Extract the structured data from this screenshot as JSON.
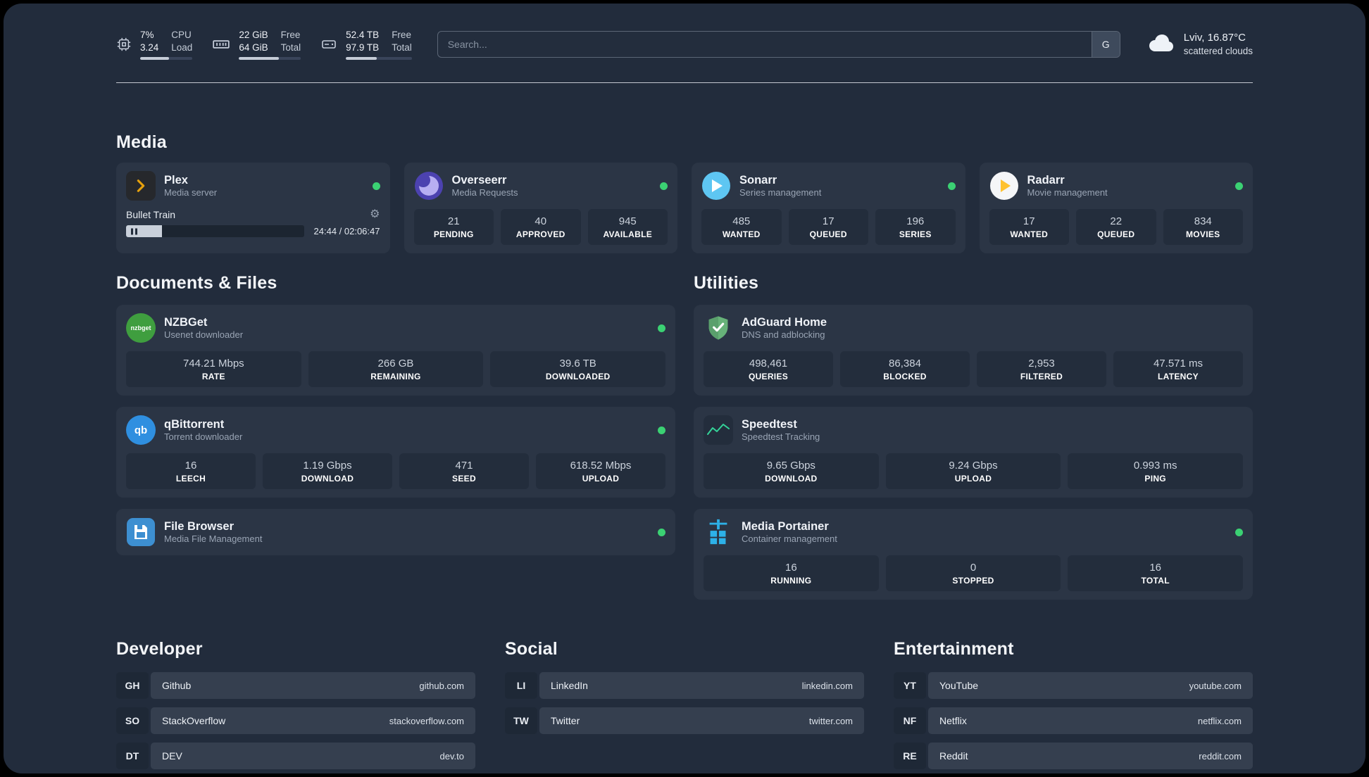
{
  "header": {
    "cpu": {
      "percent": "7%",
      "load": "3.24",
      "label1": "CPU",
      "label2": "Load",
      "bar_percent": 55
    },
    "ram": {
      "free": "22 GiB",
      "total": "64 GiB",
      "label1": "Free",
      "label2": "Total",
      "bar_percent": 65
    },
    "disk": {
      "free": "52.4 TB",
      "total": "97.9 TB",
      "label1": "Free",
      "label2": "Total",
      "bar_percent": 47
    },
    "search": {
      "placeholder": "Search...",
      "button_label": "G"
    },
    "weather": {
      "location": "Lviv, 16.87°C",
      "condition": "scattered clouds"
    }
  },
  "icons": {
    "gear": "⚙"
  },
  "sections": {
    "media": {
      "title": "Media",
      "plex": {
        "name": "Plex",
        "subtitle": "Media server",
        "now_playing": "Bullet Train",
        "time": "24:44 / 02:06:47",
        "progress_percent": 20
      },
      "overseerr": {
        "name": "Overseerr",
        "subtitle": "Media Requests",
        "stats": [
          {
            "value": "21",
            "label": "PENDING"
          },
          {
            "value": "40",
            "label": "APPROVED"
          },
          {
            "value": "945",
            "label": "AVAILABLE"
          }
        ]
      },
      "sonarr": {
        "name": "Sonarr",
        "subtitle": "Series management",
        "stats": [
          {
            "value": "485",
            "label": "WANTED"
          },
          {
            "value": "17",
            "label": "QUEUED"
          },
          {
            "value": "196",
            "label": "SERIES"
          }
        ]
      },
      "radarr": {
        "name": "Radarr",
        "subtitle": "Movie management",
        "stats": [
          {
            "value": "17",
            "label": "WANTED"
          },
          {
            "value": "22",
            "label": "QUEUED"
          },
          {
            "value": "834",
            "label": "MOVIES"
          }
        ]
      }
    },
    "documents": {
      "title": "Documents & Files",
      "nzbget": {
        "name": "NZBGet",
        "subtitle": "Usenet downloader",
        "stats": [
          {
            "value": "744.21 Mbps",
            "label": "RATE"
          },
          {
            "value": "266 GB",
            "label": "REMAINING"
          },
          {
            "value": "39.6 TB",
            "label": "DOWNLOADED"
          }
        ]
      },
      "qbittorrent": {
        "name": "qBittorrent",
        "subtitle": "Torrent downloader",
        "stats": [
          {
            "value": "16",
            "label": "LEECH"
          },
          {
            "value": "1.19 Gbps",
            "label": "DOWNLOAD"
          },
          {
            "value": "471",
            "label": "SEED"
          },
          {
            "value": "618.52 Mbps",
            "label": "UPLOAD"
          }
        ]
      },
      "filebrowser": {
        "name": "File Browser",
        "subtitle": "Media File Management"
      }
    },
    "utilities": {
      "title": "Utilities",
      "adguard": {
        "name": "AdGuard Home",
        "subtitle": "DNS and adblocking",
        "stats": [
          {
            "value": "498,461",
            "label": "QUERIES"
          },
          {
            "value": "86,384",
            "label": "BLOCKED"
          },
          {
            "value": "2,953",
            "label": "FILTERED"
          },
          {
            "value": "47.571 ms",
            "label": "LATENCY"
          }
        ]
      },
      "speedtest": {
        "name": "Speedtest",
        "subtitle": "Speedtest Tracking",
        "stats": [
          {
            "value": "9.65 Gbps",
            "label": "DOWNLOAD"
          },
          {
            "value": "9.24 Gbps",
            "label": "UPLOAD"
          },
          {
            "value": "0.993 ms",
            "label": "PING"
          }
        ]
      },
      "portainer": {
        "name": "Media Portainer",
        "subtitle": "Container management",
        "stats": [
          {
            "value": "16",
            "label": "RUNNING"
          },
          {
            "value": "0",
            "label": "STOPPED"
          },
          {
            "value": "16",
            "label": "TOTAL"
          }
        ]
      }
    },
    "bookmarks": [
      {
        "title": "Developer",
        "items": [
          {
            "abbr": "GH",
            "name": "Github",
            "url": "github.com"
          },
          {
            "abbr": "SO",
            "name": "StackOverflow",
            "url": "stackoverflow.com"
          },
          {
            "abbr": "DT",
            "name": "DEV",
            "url": "dev.to"
          }
        ]
      },
      {
        "title": "Social",
        "items": [
          {
            "abbr": "LI",
            "name": "LinkedIn",
            "url": "linkedin.com"
          },
          {
            "abbr": "TW",
            "name": "Twitter",
            "url": "twitter.com"
          }
        ]
      },
      {
        "title": "Entertainment",
        "items": [
          {
            "abbr": "YT",
            "name": "YouTube",
            "url": "youtube.com"
          },
          {
            "abbr": "NF",
            "name": "Netflix",
            "url": "netflix.com"
          },
          {
            "abbr": "RE",
            "name": "Reddit",
            "url": "reddit.com"
          }
        ]
      }
    ]
  }
}
